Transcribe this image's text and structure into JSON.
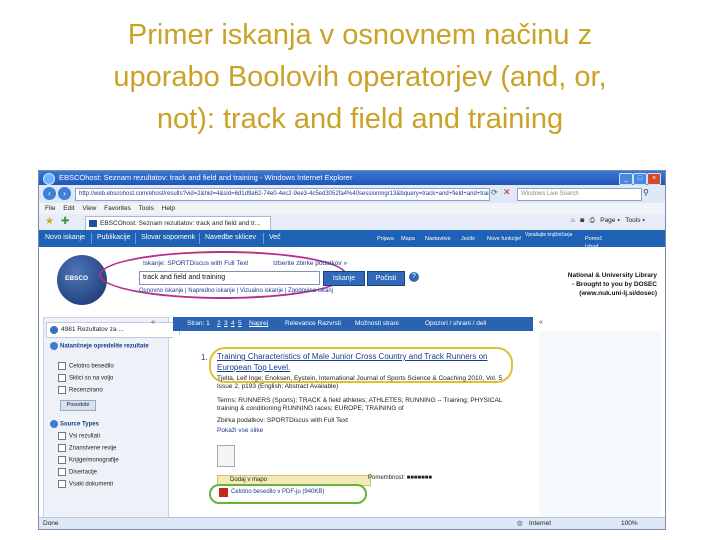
{
  "slide": {
    "title_lines": [
      "Primer iskanja v osnovnem načinu z",
      "uporabo Boolovih operatorjev (and, or,",
      "not): track and field and training"
    ],
    "title_color": "#c9a227"
  },
  "browser": {
    "window_title": "EBSCOhost: Seznam rezultatov: track and field and training - Windows Internet Explorer",
    "url": "http://web.ebscohost.com/ehost/results?vid=2&hid=4&sid=6d1d9a62-74e0-4ec2-9ee3-4c5ed3052fa4%40sessionmgr13&bquery=track+and+field+and+training",
    "live_search_placeholder": "Windows Live Search",
    "menu": [
      "File",
      "Edit",
      "View",
      "Favorites",
      "Tools",
      "Help"
    ],
    "tab_label": "EBSCOhost: Seznam rezultatov: track and field and tr...",
    "page_tools": [
      "Page",
      "Tools"
    ],
    "status": {
      "done": "Done",
      "zone": "Internet",
      "zoom": "100%"
    }
  },
  "ebsco": {
    "nav": [
      "Novo iskanje",
      "Publikacije",
      "Slovar sopomenk",
      "Navedbe sklicev",
      "Več"
    ],
    "right_links": [
      "Prijava",
      "Mapa",
      "Nastavitve",
      "Jeziki",
      "Nove funkcije!",
      "Vprašajte knjižničarja",
      "Pomoč",
      "Izhod"
    ],
    "search_label": "Iskanje: SPORTDiscus with Full Text",
    "choose_db": "Izberite zbirke podatkov »",
    "search_value": "track and field and training",
    "search_button": "Iskanje",
    "clear_button": "Počisti",
    "sub_links": [
      "Osnovno iskanje",
      "Napredno iskanje",
      "Vizualno iskanje",
      "Zgodovina iskanj"
    ],
    "library_lines": [
      "National & University Library",
      "- Brought to you by DOSEC",
      "(www.nuk.uni-lj.si/dosec)"
    ]
  },
  "left_panel": {
    "results_count": "4981 Rezultatov za ...",
    "section1_title": "Natančneje opredelite rezultate",
    "section1_items": [
      "Celotno besedilo",
      "Sklici so na voljo",
      "Recenzirano"
    ],
    "update_button": "Posodobi",
    "section2_title": "Source Types",
    "section2_items": [
      "Vsi rezultati",
      "Znanstvene revije",
      "Knjige/monografije",
      "Disertacije",
      "Vsaki dokumenti"
    ]
  },
  "results_bar": {
    "page_label": "Stran: 1",
    "pages": [
      "2",
      "3",
      "4",
      "5"
    ],
    "next": "Naprej",
    "sort": "Relevance Razvrsti",
    "options": "Možnosti strani",
    "share": "Opozori / shrani / deli"
  },
  "result": {
    "number": "1.",
    "title": "Training Characteristics of Male Junior Cross Country and Track Runners on European Top Level.",
    "meta": "Tjelta, Leif Inge; Enoksen, Eystein, International Journal of Sports Science & Coaching 2010, Vol. 5 Issue 2, p193 (English; Abstract Available)",
    "subjects": "Terms: RUNNERS (Sports); TRACK & field athletes; ATHLETES; RUNNING -- Training; PHYSICAL training & conditioning RUNNING races; EUROPE; TRAINING of",
    "database": "Zbirka podatkov: SPORTDiscus with Full Text",
    "more": "Pokaži vse slike",
    "add_folder": "Dodaj v mapo",
    "note": "Pomembnost: ■■■■■■■",
    "pdf_link": "Celotno besedilo v PDF-ju (940KB)"
  }
}
